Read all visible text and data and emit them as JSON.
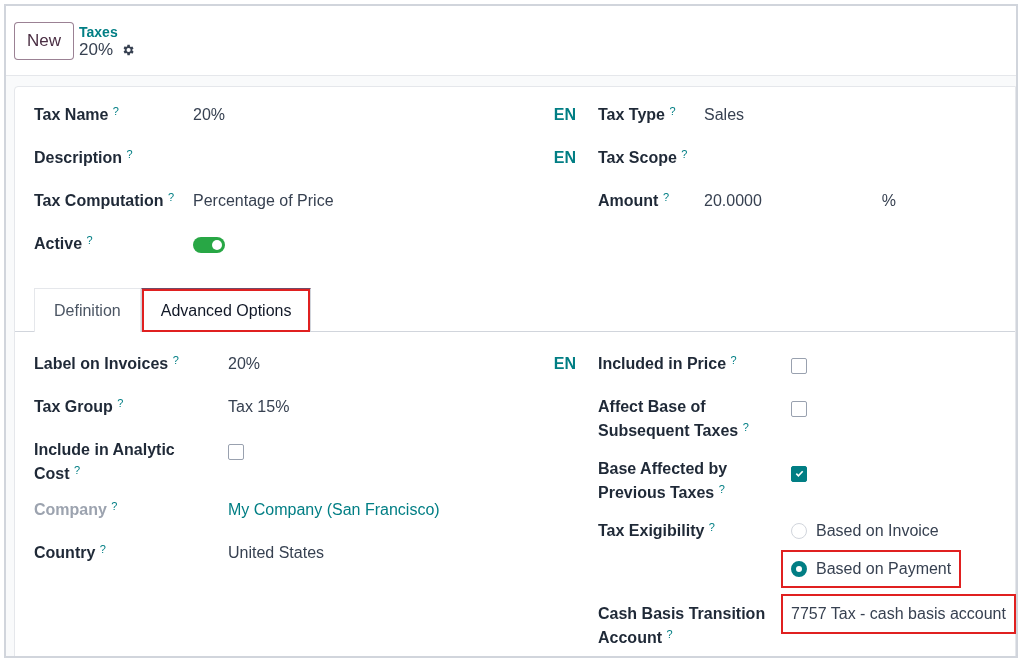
{
  "header": {
    "new_button": "New",
    "breadcrumb": "Taxes",
    "record_title": "20%"
  },
  "main_left": [
    {
      "kind": "text",
      "label": "Tax Name",
      "help": "?",
      "value": "20%",
      "lang": "EN"
    },
    {
      "kind": "text",
      "label": "Description",
      "help": "?",
      "lang": "EN"
    },
    {
      "kind": "text",
      "label": "Tax Computation",
      "help": "?",
      "value": "Percentage of Price"
    },
    {
      "kind": "toggle",
      "label": "Active",
      "help": "?",
      "on": true
    }
  ],
  "main_right": [
    {
      "kind": "text",
      "label": "Tax Type",
      "help": "?",
      "value": "Sales"
    },
    {
      "kind": "text",
      "label": "Tax Scope",
      "help": "?"
    },
    {
      "kind": "text",
      "label": "Amount",
      "help": "?",
      "value": "20.0000",
      "unit": "%"
    }
  ],
  "tabs": [
    {
      "label": "Definition",
      "selected": false,
      "highlighted": false
    },
    {
      "label": "Advanced Options",
      "selected": true,
      "highlighted": true
    }
  ],
  "tab_left": [
    {
      "kind": "text",
      "label": "Label on Invoices",
      "help": "?",
      "value": "20%",
      "lang": "EN",
      "muted": false
    },
    {
      "kind": "text",
      "label": "Tax Group",
      "help": "?",
      "value": "Tax 15%",
      "muted": false
    },
    {
      "kind": "checkbox",
      "label": "Include in Analytic Cost",
      "help": "?",
      "checked": false,
      "muted": false
    },
    {
      "kind": "link",
      "label": "Company",
      "help": "?",
      "value": "My Company (San Francisco)",
      "muted": true
    },
    {
      "kind": "text",
      "label": "Country",
      "help": "?",
      "value": "United States",
      "muted": false
    }
  ],
  "tab_right": [
    {
      "kind": "checkbox",
      "label": "Included in Price",
      "help": "?",
      "checked": false
    },
    {
      "kind": "checkbox",
      "label": "Affect Base of Subsequent Taxes",
      "help": "?",
      "checked": false
    },
    {
      "kind": "checkbox",
      "label": "Base Affected by Previous Taxes",
      "help": "?",
      "checked": true
    },
    {
      "kind": "radio",
      "label": "Tax Exigibility",
      "help": "?",
      "options": [
        {
          "label": "Based on Invoice",
          "selected": false,
          "highlighted": false
        },
        {
          "label": "Based on Payment",
          "selected": true,
          "highlighted": true
        }
      ]
    },
    {
      "kind": "text",
      "label": "Cash Basis Transition Account",
      "help": "?",
      "value": "7757 Tax - cash basis account",
      "highlighted": true
    }
  ]
}
